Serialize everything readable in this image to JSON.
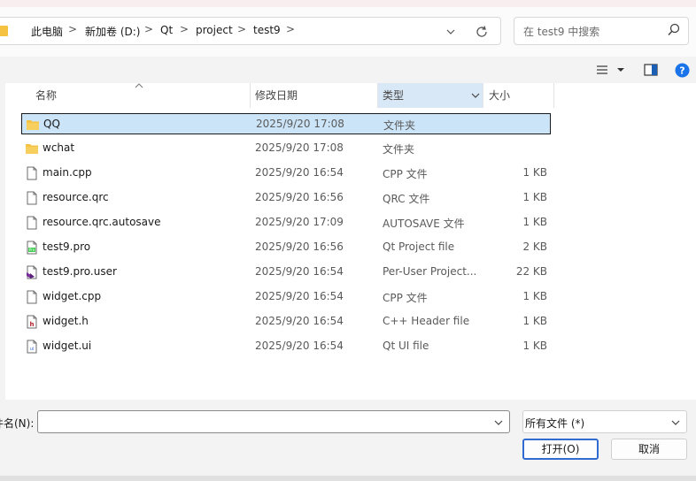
{
  "address_bar": {
    "breadcrumbs": [
      "此电脑",
      "新加卷 (D:)",
      "Qt",
      "project",
      "test9"
    ],
    "separator": ">"
  },
  "search": {
    "placeholder": "在 test9 中搜索"
  },
  "columns": {
    "name": "名称",
    "date": "修改日期",
    "type": "类型",
    "size": "大小"
  },
  "files": [
    {
      "name": "QQ",
      "date": "2025/9/20 17:08",
      "type": "文件夹",
      "size": "",
      "icon": "folder-icon",
      "selected": true
    },
    {
      "name": "wchat",
      "date": "2025/9/20 17:08",
      "type": "文件夹",
      "size": "",
      "icon": "folder-icon",
      "selected": false
    },
    {
      "name": "main.cpp",
      "date": "2025/9/20 16:54",
      "type": "CPP 文件",
      "size": "1 KB",
      "icon": "document-icon",
      "selected": false
    },
    {
      "name": "resource.qrc",
      "date": "2025/9/20 16:56",
      "type": "QRC 文件",
      "size": "1 KB",
      "icon": "document-icon",
      "selected": false
    },
    {
      "name": "resource.qrc.autosave",
      "date": "2025/9/20 17:09",
      "type": "AUTOSAVE 文件",
      "size": "1 KB",
      "icon": "document-icon",
      "selected": false
    },
    {
      "name": "test9.pro",
      "date": "2025/9/20 16:56",
      "type": "Qt Project file",
      "size": "2 KB",
      "icon": "qt-pro-file-icon",
      "selected": false
    },
    {
      "name": "test9.pro.user",
      "date": "2025/9/20 16:54",
      "type": "Per-User Project...",
      "size": "22 KB",
      "icon": "visual-studio-file-icon",
      "selected": false
    },
    {
      "name": "widget.cpp",
      "date": "2025/9/20 16:54",
      "type": "CPP 文件",
      "size": "1 KB",
      "icon": "document-icon",
      "selected": false
    },
    {
      "name": "widget.h",
      "date": "2025/9/20 16:54",
      "type": "C++ Header file",
      "size": "1 KB",
      "icon": "header-file-icon",
      "selected": false
    },
    {
      "name": "widget.ui",
      "date": "2025/9/20 16:54",
      "type": "Qt UI file",
      "size": "1 KB",
      "icon": "qt-ui-file-icon",
      "selected": false
    }
  ],
  "filename": {
    "label": "件名(N):",
    "value": ""
  },
  "filetype": {
    "selected": "所有文件 (*)"
  },
  "buttons": {
    "open": "打开(O)",
    "cancel": "取消"
  },
  "colors": {
    "accent": "#2f6bd0",
    "selection": "#cce4f7",
    "folder": "#f5c242",
    "help": "#1a73e8"
  }
}
